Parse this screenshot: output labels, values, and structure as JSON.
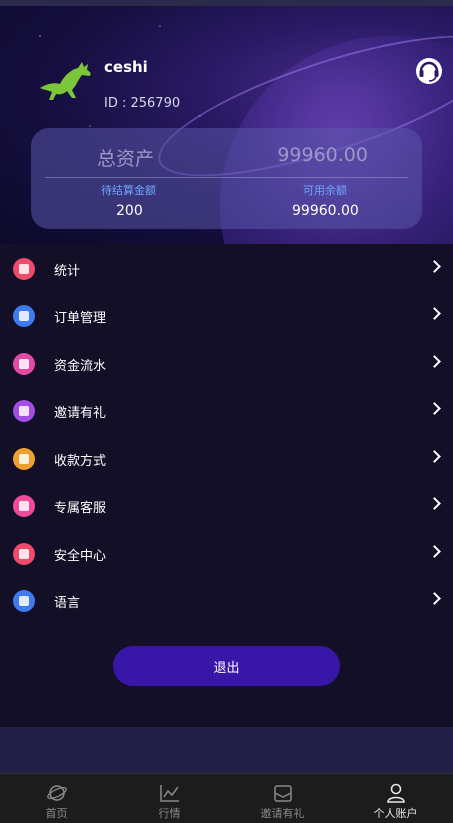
{
  "user": {
    "name": "ceshi",
    "id_text": "ID : 256790"
  },
  "assets": {
    "title": "总资产",
    "total": "99960.00",
    "pending_label": "待结算金额",
    "pending_value": "200",
    "available_label": "可用余额",
    "available_value": "99960.00"
  },
  "menu": [
    {
      "label": "统计",
      "icon": "stats-icon",
      "color": "#f04a6a"
    },
    {
      "label": "订单管理",
      "icon": "order-icon",
      "color": "#3f7af0"
    },
    {
      "label": "资金流水",
      "icon": "funds-flow-icon",
      "color": "#e24aa6"
    },
    {
      "label": "邀请有礼",
      "icon": "invite-icon",
      "color": "#a24ee6"
    },
    {
      "label": "收款方式",
      "icon": "payment-method-icon",
      "color": "#f0a030"
    },
    {
      "label": "专属客服",
      "icon": "customer-service-icon",
      "color": "#f04a9a"
    },
    {
      "label": "安全中心",
      "icon": "security-icon",
      "color": "#f04a6a"
    },
    {
      "label": "语言",
      "icon": "language-icon",
      "color": "#3f7af0"
    }
  ],
  "logout_label": "退出",
  "tabs": [
    {
      "label": "首页",
      "icon": "home-planet-icon"
    },
    {
      "label": "行情",
      "icon": "market-chart-icon"
    },
    {
      "label": "邀请有礼",
      "icon": "invite-envelope-icon"
    },
    {
      "label": "个人账户",
      "icon": "user-account-icon",
      "active": true
    }
  ]
}
